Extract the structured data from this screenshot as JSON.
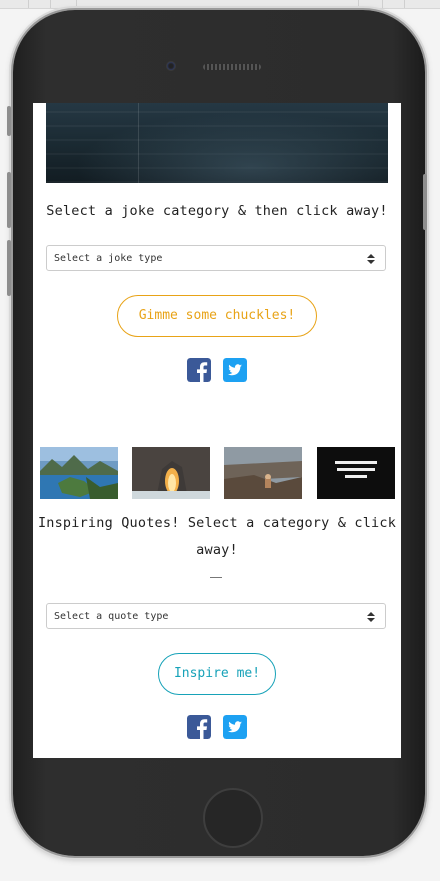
{
  "joke_section": {
    "heading": "Select a joke category & then click away!",
    "select_placeholder": "Select a joke type",
    "button_label": "Gimme some chuckles!",
    "accent": "#e8a317"
  },
  "quote_section": {
    "heading_line1": "Inspiring Quotes! Select a category & click",
    "heading_line2": "away!",
    "select_placeholder": "Select a quote type",
    "button_label": "Inspire me!",
    "accent": "#17a2b8"
  },
  "quote_image_4_text": "YOU DIDN'T COME THIS FAR TO ONLY COME THIS FAR",
  "icons": [
    "facebook-icon",
    "twitter-icon"
  ],
  "colors": {
    "facebook": "#3b5998",
    "twitter": "#1da1f2"
  }
}
